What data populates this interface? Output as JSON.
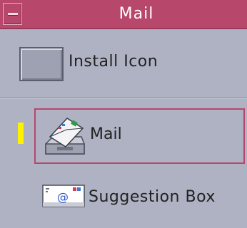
{
  "window": {
    "title": "Mail",
    "title_color": "#b8476c",
    "background_color": "#aeb2c3"
  },
  "install": {
    "label": "Install Icon"
  },
  "items": [
    {
      "label": "Mail",
      "icon": "mail-tray-icon",
      "selected": true,
      "indicator_color": "#fff200"
    },
    {
      "label": "Suggestion Box",
      "icon": "email-envelope-icon",
      "selected": false
    }
  ]
}
